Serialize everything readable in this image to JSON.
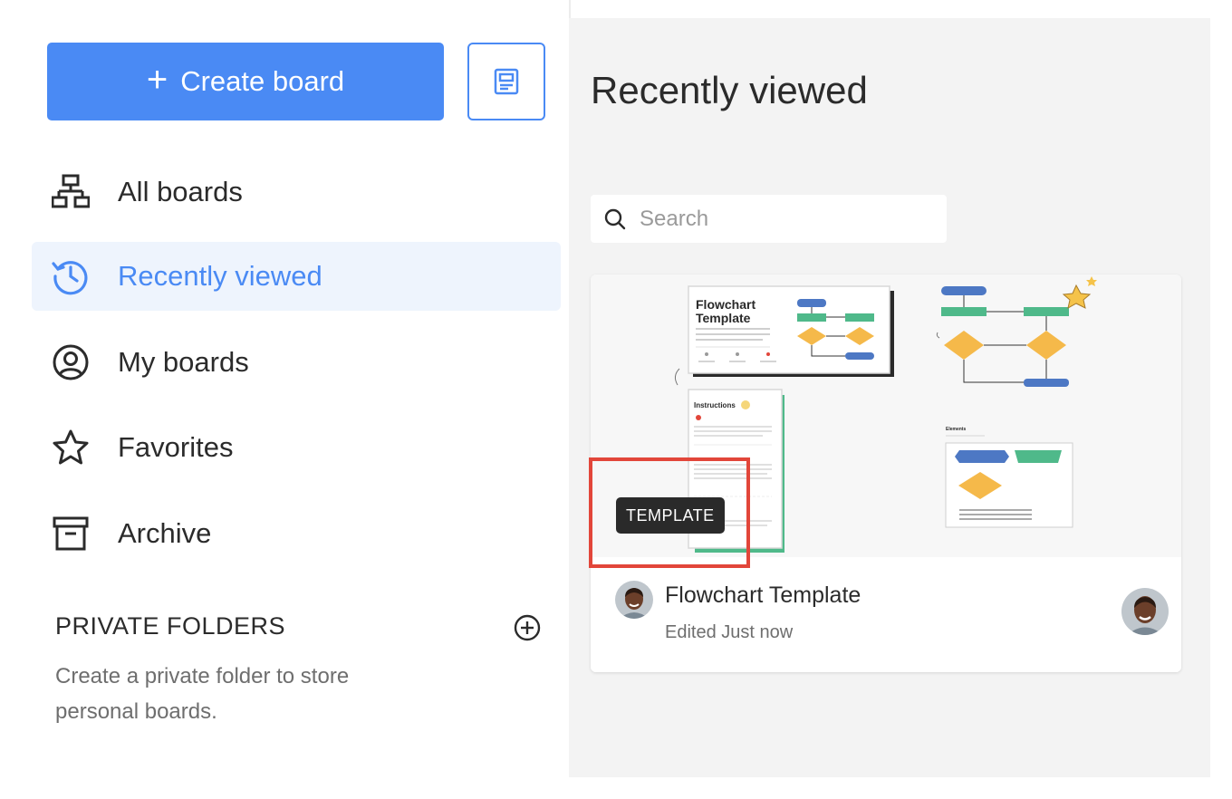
{
  "sidebar": {
    "create_label": "Create board",
    "nav": [
      {
        "label": "All boards",
        "icon": "sitemap-icon"
      },
      {
        "label": "Recently viewed",
        "icon": "history-icon",
        "active": true
      },
      {
        "label": "My boards",
        "icon": "user-circle-icon"
      },
      {
        "label": "Favorites",
        "icon": "star-icon"
      },
      {
        "label": "Archive",
        "icon": "archive-icon"
      }
    ],
    "private_folders_title": "PRIVATE FOLDERS",
    "private_folders_desc": "Create a private folder to store personal boards."
  },
  "main": {
    "title": "Recently viewed",
    "search_placeholder": "Search",
    "card": {
      "name": "Flowchart Template",
      "edited": "Edited Just now",
      "badge": "TEMPLATE",
      "thumb": {
        "doc_title": "Flowchart Template",
        "instructions_title": "Instructions",
        "elements_title": "Elements"
      }
    }
  },
  "colors": {
    "accent": "#4a8af4",
    "active_bg": "#eef4fd",
    "highlight": "#e2463a",
    "flow_blue": "#4d78c4",
    "flow_green": "#4fb98a",
    "flow_yellow": "#f5b94a"
  }
}
